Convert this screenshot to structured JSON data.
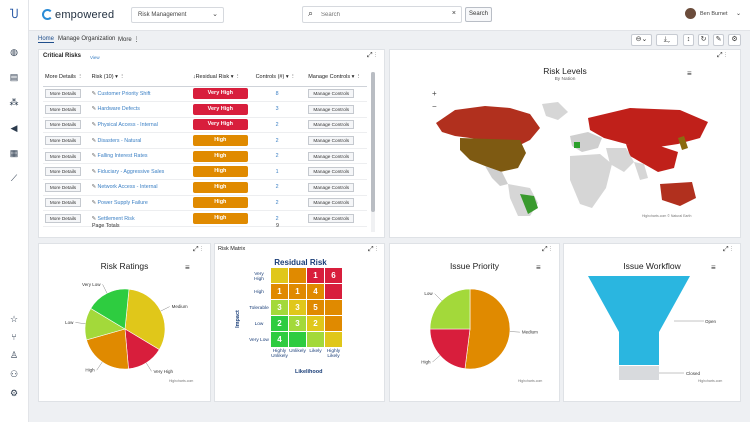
{
  "app": {
    "brand": "empowered",
    "scope": "Risk Management",
    "search_placeholder": "Search",
    "search_button": "Search",
    "user": "Ben Burnet"
  },
  "tabs": {
    "home": "Home",
    "manage_org": "Manage Organization",
    "more": "More"
  },
  "critical_risks": {
    "title": "Critical Risks",
    "view": "View",
    "headers": {
      "more": "More Details",
      "risk": "Risk (10)",
      "residual": "Residual Risk",
      "controls": "Controls (#)",
      "manage": "Manage Controls"
    },
    "more_btn": "More Details",
    "manage_btn": "Manage Controls",
    "rows": [
      {
        "name": "Customer Priority Shift",
        "level": "Very High",
        "color": "#d81e3c",
        "count": "8"
      },
      {
        "name": "Hardware Defects",
        "level": "Very High",
        "color": "#d81e3c",
        "count": "3"
      },
      {
        "name": "Physical Access - Internal",
        "level": "Very High",
        "color": "#d81e3c",
        "count": "2"
      },
      {
        "name": "Disasters - Natural",
        "level": "High",
        "color": "#e08a00",
        "count": "2"
      },
      {
        "name": "Falling Interest Rates",
        "level": "High",
        "color": "#e08a00",
        "count": "2"
      },
      {
        "name": "Fiduciary - Aggressive Sales",
        "level": "High",
        "color": "#e08a00",
        "count": "1"
      },
      {
        "name": "Network Access - Internal",
        "level": "High",
        "color": "#e08a00",
        "count": "2"
      },
      {
        "name": "Power Supply Failure",
        "level": "High",
        "color": "#e08a00",
        "count": "2"
      },
      {
        "name": "Settlement Risk",
        "level": "High",
        "color": "#e08a00",
        "count": "2"
      }
    ],
    "page_totals_label": "Page Totals",
    "page_totals_value": "9"
  },
  "risk_levels": {
    "title": "Risk Levels",
    "subtitle": "By Nation",
    "credit": "Highcharts.com © Natural Earth",
    "zoom_in": "+",
    "zoom_out": "−"
  },
  "risk_ratings": {
    "title": "Risk Ratings",
    "credit": "Highcharts.com",
    "chart_data": {
      "type": "pie",
      "slices": [
        {
          "label": "Medium",
          "value": 32,
          "color": "#e0c71a"
        },
        {
          "label": "Very High",
          "value": 15,
          "color": "#d81e3c"
        },
        {
          "label": "High",
          "value": 22,
          "color": "#e08a00"
        },
        {
          "label": "Low",
          "value": 13,
          "color": "#a3d93a"
        },
        {
          "label": "Very Low",
          "value": 18,
          "color": "#2ecc40"
        }
      ]
    }
  },
  "risk_matrix": {
    "card_title": "Risk Matrix",
    "title": "Residual Risk",
    "y_axis": "Impact",
    "x_axis": "Likelihood",
    "rows": [
      "Very High",
      "High",
      "Tolerable",
      "Low",
      "Very Low"
    ],
    "cols": [
      "Highly Unlikely",
      "Unlikely",
      "Likely",
      "Highly Likely"
    ],
    "cells": [
      [
        {
          "v": "",
          "c": "#e0c71a"
        },
        {
          "v": "",
          "c": "#e08a00"
        },
        {
          "v": "1",
          "c": "#d81e3c"
        },
        {
          "v": "6",
          "c": "#d81e3c"
        }
      ],
      [
        {
          "v": "1",
          "c": "#e08a00"
        },
        {
          "v": "1",
          "c": "#e08a00"
        },
        {
          "v": "4",
          "c": "#e08a00"
        },
        {
          "v": "",
          "c": "#d81e3c"
        }
      ],
      [
        {
          "v": "3",
          "c": "#a3d93a"
        },
        {
          "v": "3",
          "c": "#e0c71a"
        },
        {
          "v": "5",
          "c": "#e08a00"
        },
        {
          "v": "",
          "c": "#e08a00"
        }
      ],
      [
        {
          "v": "2",
          "c": "#2ecc40"
        },
        {
          "v": "3",
          "c": "#a3d93a"
        },
        {
          "v": "2",
          "c": "#e0c71a"
        },
        {
          "v": "",
          "c": "#e08a00"
        }
      ],
      [
        {
          "v": "4",
          "c": "#2ecc40"
        },
        {
          "v": "",
          "c": "#2ecc40"
        },
        {
          "v": "",
          "c": "#a3d93a"
        },
        {
          "v": "",
          "c": "#e0c71a"
        }
      ]
    ]
  },
  "issue_priority": {
    "title": "Issue Priority",
    "credit": "Highcharts.com",
    "chart_data": {
      "type": "pie",
      "slices": [
        {
          "label": "Medium",
          "value": 52,
          "color": "#e08a00"
        },
        {
          "label": "High",
          "value": 23,
          "color": "#d81e3c"
        },
        {
          "label": "Low",
          "value": 25,
          "color": "#a3d93a"
        }
      ]
    }
  },
  "issue_workflow": {
    "title": "Issue Workflow",
    "credit": "Highcharts.com",
    "chart_data": {
      "type": "funnel",
      "stages": [
        {
          "label": "Open",
          "color": "#2ab6e0"
        },
        {
          "label": "Closed",
          "color": "#d8dadd"
        }
      ]
    }
  }
}
